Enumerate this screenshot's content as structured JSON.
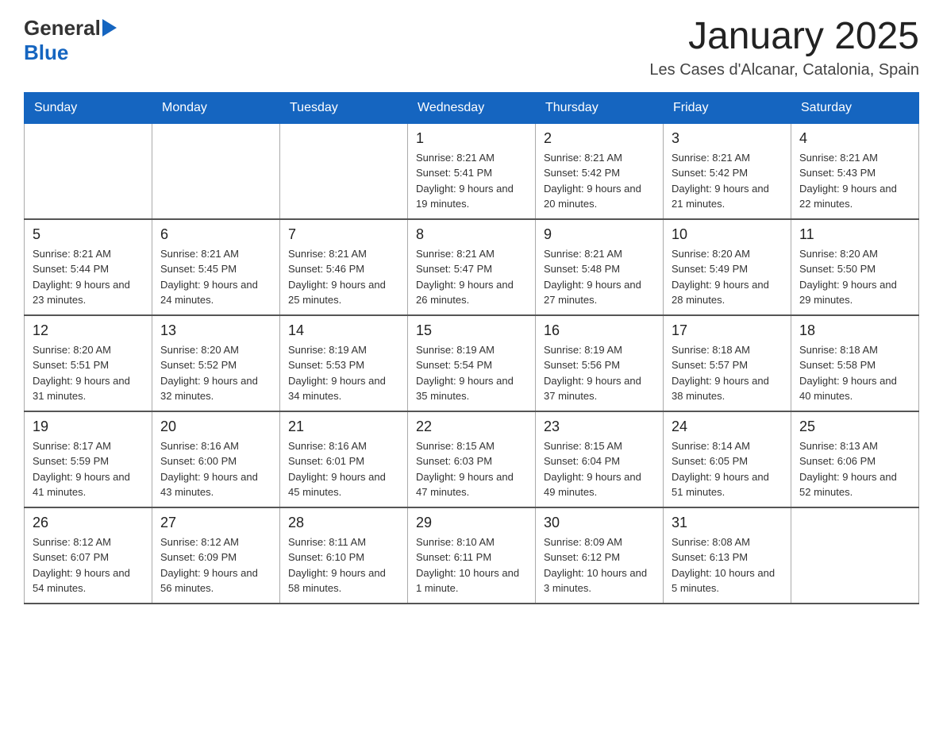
{
  "header": {
    "logo": {
      "general": "General",
      "blue": "Blue",
      "arrow": "▶"
    },
    "title": "January 2025",
    "subtitle": "Les Cases d'Alcanar, Catalonia, Spain"
  },
  "calendar": {
    "days_of_week": [
      "Sunday",
      "Monday",
      "Tuesday",
      "Wednesday",
      "Thursday",
      "Friday",
      "Saturday"
    ],
    "weeks": [
      [
        {
          "day": "",
          "info": ""
        },
        {
          "day": "",
          "info": ""
        },
        {
          "day": "",
          "info": ""
        },
        {
          "day": "1",
          "info": "Sunrise: 8:21 AM\nSunset: 5:41 PM\nDaylight: 9 hours\nand 19 minutes."
        },
        {
          "day": "2",
          "info": "Sunrise: 8:21 AM\nSunset: 5:42 PM\nDaylight: 9 hours\nand 20 minutes."
        },
        {
          "day": "3",
          "info": "Sunrise: 8:21 AM\nSunset: 5:42 PM\nDaylight: 9 hours\nand 21 minutes."
        },
        {
          "day": "4",
          "info": "Sunrise: 8:21 AM\nSunset: 5:43 PM\nDaylight: 9 hours\nand 22 minutes."
        }
      ],
      [
        {
          "day": "5",
          "info": "Sunrise: 8:21 AM\nSunset: 5:44 PM\nDaylight: 9 hours\nand 23 minutes."
        },
        {
          "day": "6",
          "info": "Sunrise: 8:21 AM\nSunset: 5:45 PM\nDaylight: 9 hours\nand 24 minutes."
        },
        {
          "day": "7",
          "info": "Sunrise: 8:21 AM\nSunset: 5:46 PM\nDaylight: 9 hours\nand 25 minutes."
        },
        {
          "day": "8",
          "info": "Sunrise: 8:21 AM\nSunset: 5:47 PM\nDaylight: 9 hours\nand 26 minutes."
        },
        {
          "day": "9",
          "info": "Sunrise: 8:21 AM\nSunset: 5:48 PM\nDaylight: 9 hours\nand 27 minutes."
        },
        {
          "day": "10",
          "info": "Sunrise: 8:20 AM\nSunset: 5:49 PM\nDaylight: 9 hours\nand 28 minutes."
        },
        {
          "day": "11",
          "info": "Sunrise: 8:20 AM\nSunset: 5:50 PM\nDaylight: 9 hours\nand 29 minutes."
        }
      ],
      [
        {
          "day": "12",
          "info": "Sunrise: 8:20 AM\nSunset: 5:51 PM\nDaylight: 9 hours\nand 31 minutes."
        },
        {
          "day": "13",
          "info": "Sunrise: 8:20 AM\nSunset: 5:52 PM\nDaylight: 9 hours\nand 32 minutes."
        },
        {
          "day": "14",
          "info": "Sunrise: 8:19 AM\nSunset: 5:53 PM\nDaylight: 9 hours\nand 34 minutes."
        },
        {
          "day": "15",
          "info": "Sunrise: 8:19 AM\nSunset: 5:54 PM\nDaylight: 9 hours\nand 35 minutes."
        },
        {
          "day": "16",
          "info": "Sunrise: 8:19 AM\nSunset: 5:56 PM\nDaylight: 9 hours\nand 37 minutes."
        },
        {
          "day": "17",
          "info": "Sunrise: 8:18 AM\nSunset: 5:57 PM\nDaylight: 9 hours\nand 38 minutes."
        },
        {
          "day": "18",
          "info": "Sunrise: 8:18 AM\nSunset: 5:58 PM\nDaylight: 9 hours\nand 40 minutes."
        }
      ],
      [
        {
          "day": "19",
          "info": "Sunrise: 8:17 AM\nSunset: 5:59 PM\nDaylight: 9 hours\nand 41 minutes."
        },
        {
          "day": "20",
          "info": "Sunrise: 8:16 AM\nSunset: 6:00 PM\nDaylight: 9 hours\nand 43 minutes."
        },
        {
          "day": "21",
          "info": "Sunrise: 8:16 AM\nSunset: 6:01 PM\nDaylight: 9 hours\nand 45 minutes."
        },
        {
          "day": "22",
          "info": "Sunrise: 8:15 AM\nSunset: 6:03 PM\nDaylight: 9 hours\nand 47 minutes."
        },
        {
          "day": "23",
          "info": "Sunrise: 8:15 AM\nSunset: 6:04 PM\nDaylight: 9 hours\nand 49 minutes."
        },
        {
          "day": "24",
          "info": "Sunrise: 8:14 AM\nSunset: 6:05 PM\nDaylight: 9 hours\nand 51 minutes."
        },
        {
          "day": "25",
          "info": "Sunrise: 8:13 AM\nSunset: 6:06 PM\nDaylight: 9 hours\nand 52 minutes."
        }
      ],
      [
        {
          "day": "26",
          "info": "Sunrise: 8:12 AM\nSunset: 6:07 PM\nDaylight: 9 hours\nand 54 minutes."
        },
        {
          "day": "27",
          "info": "Sunrise: 8:12 AM\nSunset: 6:09 PM\nDaylight: 9 hours\nand 56 minutes."
        },
        {
          "day": "28",
          "info": "Sunrise: 8:11 AM\nSunset: 6:10 PM\nDaylight: 9 hours\nand 58 minutes."
        },
        {
          "day": "29",
          "info": "Sunrise: 8:10 AM\nSunset: 6:11 PM\nDaylight: 10 hours\nand 1 minute."
        },
        {
          "day": "30",
          "info": "Sunrise: 8:09 AM\nSunset: 6:12 PM\nDaylight: 10 hours\nand 3 minutes."
        },
        {
          "day": "31",
          "info": "Sunrise: 8:08 AM\nSunset: 6:13 PM\nDaylight: 10 hours\nand 5 minutes."
        },
        {
          "day": "",
          "info": ""
        }
      ]
    ]
  }
}
